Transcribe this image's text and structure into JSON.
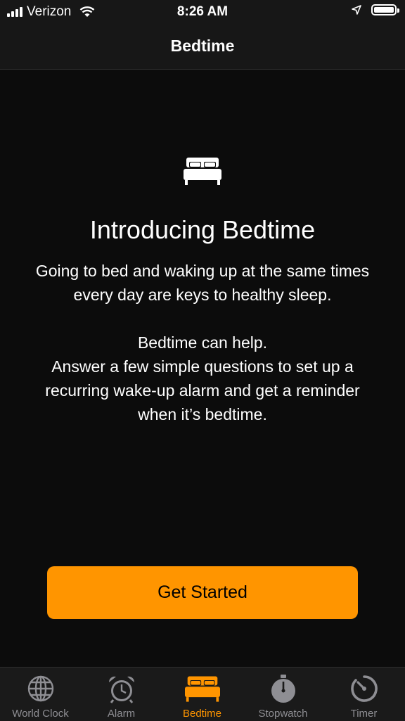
{
  "status_bar": {
    "carrier": "Verizon",
    "time": "8:26 AM"
  },
  "nav": {
    "title": "Bedtime"
  },
  "intro": {
    "heading": "Introducing Bedtime",
    "line1": "Going to bed and waking up at the same times",
    "line2": "every day are keys to healthy sleep.",
    "line3": "Bedtime can help.",
    "line4": "Answer a few simple questions to set up a",
    "line5": "recurring wake-up alarm and get a reminder",
    "line6": "when it’s bedtime."
  },
  "cta": {
    "label": "Get Started"
  },
  "tabs": [
    {
      "label": "World Clock",
      "icon": "globe-icon"
    },
    {
      "label": "Alarm",
      "icon": "alarm-clock-icon"
    },
    {
      "label": "Bedtime",
      "icon": "bed-icon",
      "active": true
    },
    {
      "label": "Stopwatch",
      "icon": "stopwatch-icon"
    },
    {
      "label": "Timer",
      "icon": "timer-icon"
    }
  ],
  "colors": {
    "accent": "#ff9500",
    "background": "#0c0c0c",
    "bar": "#171717",
    "inactive": "#8e8e93"
  }
}
